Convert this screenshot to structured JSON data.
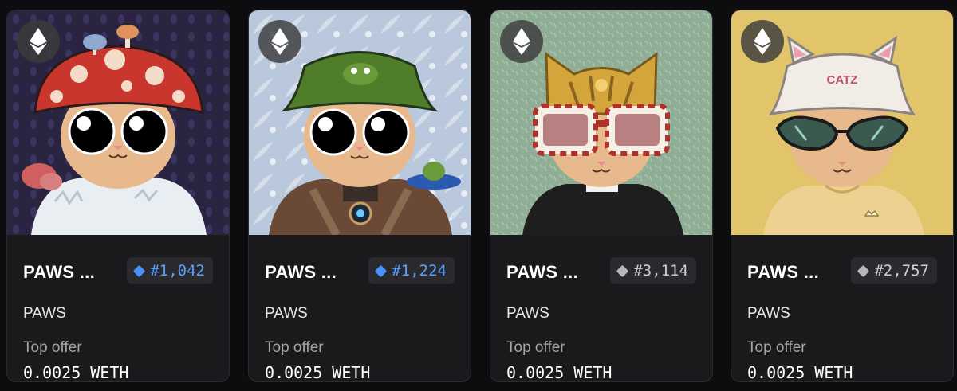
{
  "cards": [
    {
      "name": "PAWS ...",
      "rank": "#1,042",
      "rank_color": "#5aa0ff",
      "rank_tier_color": "#4a90ff",
      "collection": "PAWS",
      "offer_label": "Top offer",
      "offer_value": "0.0025 WETH",
      "chain_icon": "ethereum-icon",
      "art": {
        "bg": "#2a2440",
        "skin": "#e8b98c",
        "hat": "red-mushroom",
        "hat_color": "#c9362e",
        "body": "white-fur",
        "body_color": "#e8eef2",
        "eyewear": "none"
      }
    },
    {
      "name": "PAWS ...",
      "rank": "#1,224",
      "rank_color": "#5aa0ff",
      "rank_tier_color": "#4a90ff",
      "collection": "PAWS",
      "offer_label": "Top offer",
      "offer_value": "0.0025 WETH",
      "chain_icon": "ethereum-icon",
      "art": {
        "bg": "#b9c8dc",
        "skin": "#e8b98c",
        "hat": "green-bucket-hat",
        "hat_color": "#4f7d2a",
        "body": "armor",
        "body_color": "#6a4a36",
        "eyewear": "none"
      }
    },
    {
      "name": "PAWS ...",
      "rank": "#3,114",
      "rank_color": "#cfcfcf",
      "rank_tier_color": "#b8b8b8",
      "collection": "PAWS",
      "offer_label": "Top offer",
      "offer_value": "0.0025 WETH",
      "chain_icon": "ethereum-icon",
      "art": {
        "bg": "#8fae95",
        "skin": "#e8b98c",
        "hat": "gold-cat-mask",
        "hat_color": "#d4a53a",
        "body": "priest-collar",
        "body_color": "#1e1e1e",
        "eyewear": "striped-glasses"
      }
    },
    {
      "name": "PAWS ...",
      "rank": "#2,757",
      "rank_color": "#cfcfcf",
      "rank_tier_color": "#b8b8b8",
      "collection": "PAWS",
      "offer_label": "Top offer",
      "offer_value": "0.0025 WETH",
      "chain_icon": "ethereum-icon",
      "art": {
        "bg": "#e2c46a",
        "skin": "#e8b98c",
        "hat": "white-catz-hat",
        "hat_color": "#f1ece6",
        "hat_text": "CATZ",
        "body": "tee",
        "body_color": "#ecd190",
        "eyewear": "cat-eye-sunglasses"
      }
    }
  ]
}
